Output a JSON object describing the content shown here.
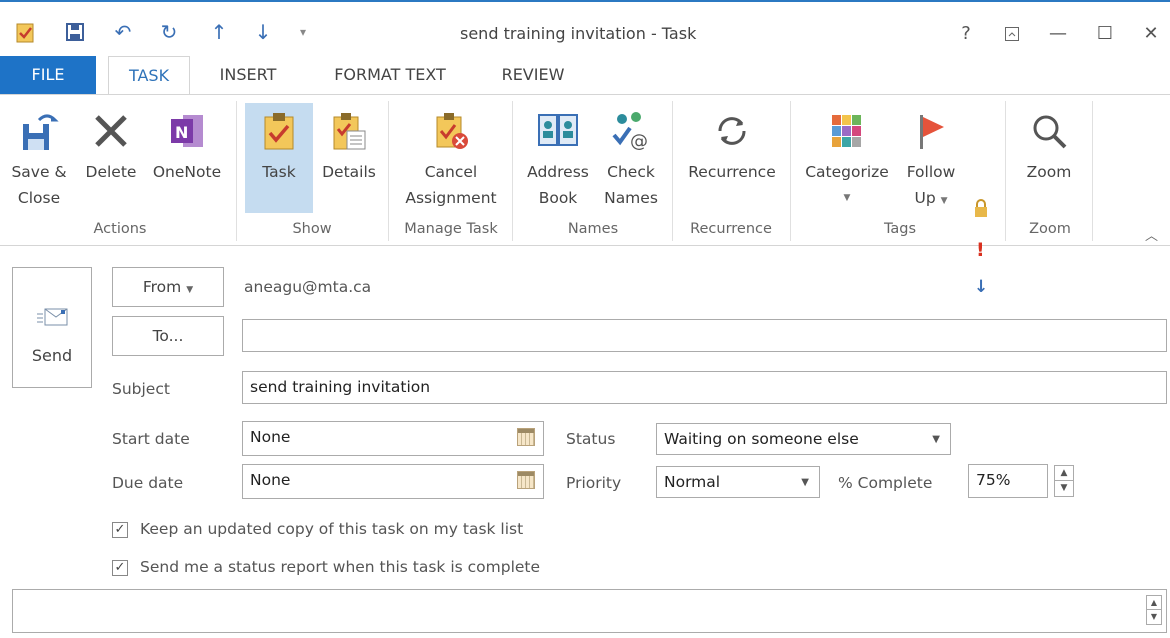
{
  "window": {
    "title": "send training invitation - Task",
    "help": "?",
    "minimize": "—",
    "maximize": "☐",
    "close": "✕"
  },
  "tabs": [
    {
      "label": "FILE"
    },
    {
      "label": "TASK"
    },
    {
      "label": "INSERT"
    },
    {
      "label": "FORMAT TEXT"
    },
    {
      "label": "REVIEW"
    }
  ],
  "ribbon": {
    "save_close": [
      "Save &",
      "Close"
    ],
    "delete": "Delete",
    "onenote": "OneNote",
    "task": "Task",
    "details": "Details",
    "cancel_assignment": [
      "Cancel",
      "Assignment"
    ],
    "address_book": [
      "Address",
      "Book"
    ],
    "check_names": [
      "Check",
      "Names"
    ],
    "recurrence": "Recurrence",
    "categorize": "Categorize",
    "follow_up": [
      "Follow",
      "Up"
    ],
    "zoom": "Zoom",
    "groups": [
      "Actions",
      "Show",
      "Manage Task",
      "Names",
      "Recurrence",
      "Tags",
      "Zoom"
    ]
  },
  "form": {
    "send": "Send",
    "from_button": "From",
    "from_value": "aneagu@mta.ca",
    "to_button": "To...",
    "to_value": "",
    "subject_label": "Subject",
    "subject_value": "send training invitation",
    "start_date_label": "Start date",
    "start_date_value": "None",
    "due_date_label": "Due date",
    "due_date_value": "None",
    "status_label": "Status",
    "status_value": "Waiting on someone else",
    "priority_label": "Priority",
    "priority_value": "Normal",
    "complete_label": "% Complete",
    "complete_value": "75%",
    "keep_copy_label": "Keep an updated copy of this task on my task list",
    "keep_copy_checked": true,
    "status_report_label": "Send me a status report when this task is complete",
    "status_report_checked": true
  },
  "colors": {
    "accent": "#1e73c7",
    "pressed": "#c5dcf0"
  }
}
